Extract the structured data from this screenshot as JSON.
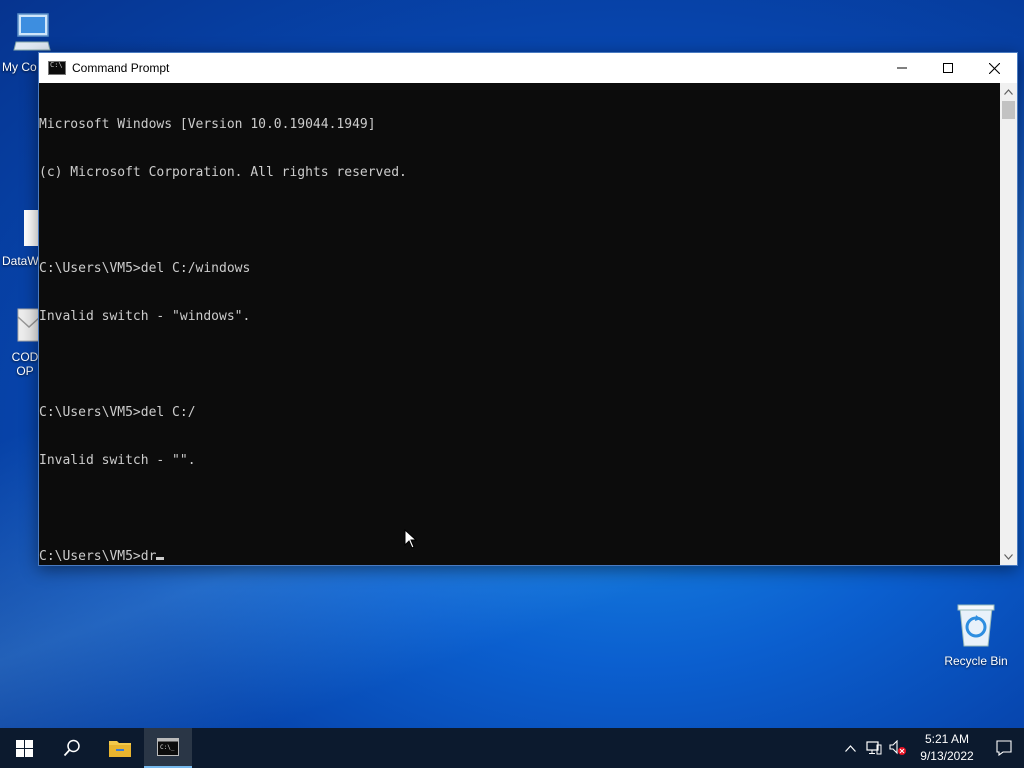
{
  "desktop": {
    "icons": [
      {
        "label": "My Co",
        "icon": "computer-icon"
      },
      {
        "label": "DataW",
        "icon": "file-icon"
      },
      {
        "label": "COD",
        "label2": "OP",
        "icon": "mail-icon"
      },
      {
        "label": "Recycle Bin",
        "icon": "recycle-bin-icon"
      }
    ]
  },
  "window": {
    "title": "Command Prompt",
    "buttons": {
      "minimize": "—",
      "maximize": "☐",
      "close": "✕"
    }
  },
  "console": {
    "lines": [
      "Microsoft Windows [Version 10.0.19044.1949]",
      "(c) Microsoft Corporation. All rights reserved.",
      "",
      "C:\\Users\\VM5>del C:/windows",
      "Invalid switch - \"windows\".",
      "",
      "C:\\Users\\VM5>del C:/",
      "Invalid switch - \"\".",
      ""
    ],
    "current_prompt": "C:\\Users\\VM5>dr"
  },
  "taskbar": {
    "items": [
      "start-icon",
      "search-icon",
      "file-explorer-icon",
      "command-prompt-icon"
    ],
    "time": "5:21 AM",
    "date": "9/13/2022"
  }
}
